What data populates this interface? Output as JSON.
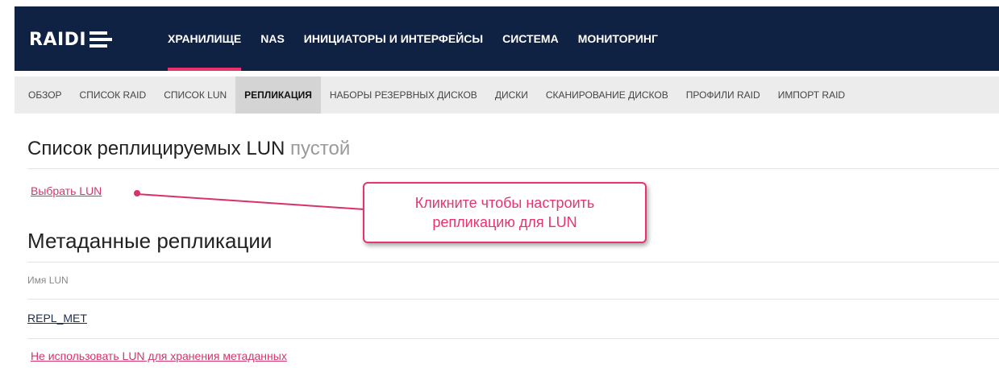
{
  "brand": {
    "logo_text": "RAIDI"
  },
  "topnav": {
    "items": [
      {
        "label": "ХРАНИЛИЩЕ",
        "active": true
      },
      {
        "label": "NAS",
        "active": false
      },
      {
        "label": "ИНИЦИАТОРЫ И ИНТЕРФЕЙСЫ",
        "active": false
      },
      {
        "label": "СИСТЕМА",
        "active": false
      },
      {
        "label": "МОНИТОРИНГ",
        "active": false
      }
    ]
  },
  "subnav": {
    "items": [
      {
        "label": "ОБЗОР",
        "active": false
      },
      {
        "label": "СПИСОК RAID",
        "active": false
      },
      {
        "label": "СПИСОК LUN",
        "active": false
      },
      {
        "label": "РЕПЛИКАЦИЯ",
        "active": true
      },
      {
        "label": "НАБОРЫ РЕЗЕРВНЫХ ДИСКОВ",
        "active": false
      },
      {
        "label": "ДИСКИ",
        "active": false
      },
      {
        "label": "СКАНИРОВАНИЕ ДИСКОВ",
        "active": false
      },
      {
        "label": "ПРОФИЛИ RAID",
        "active": false
      },
      {
        "label": "ИМПОРТ RAID",
        "active": false
      }
    ]
  },
  "replicated": {
    "title": "Список реплицируемых LUN",
    "status": "пустой",
    "select_link": "Выбрать LUN"
  },
  "callout": {
    "line1": "Кликните чтобы настроить",
    "line2": "репликацию для LUN"
  },
  "metadata": {
    "title": "Метаданные репликации",
    "column_header": "Имя LUN",
    "lun_name": "REPL_MET",
    "unuse_link": "Не использовать LUN для хранения метаданных"
  },
  "colors": {
    "topbar_bg": "#0f2244",
    "accent": "#e8336d",
    "subbar_bg": "#ececec"
  }
}
